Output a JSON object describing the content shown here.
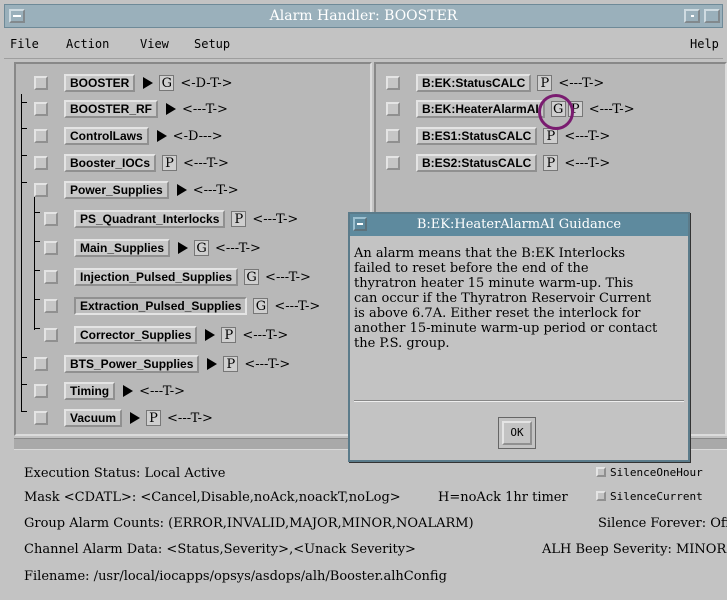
{
  "window": {
    "title": "Alarm Handler: BOOSTER"
  },
  "menu": {
    "file": "File",
    "action": "Action",
    "view": "View",
    "setup": "Setup",
    "help": "Help"
  },
  "tree": [
    {
      "label": "BOOSTER",
      "arrow": true,
      "gp": "G",
      "state": "<-D-T->"
    },
    {
      "label": "BOOSTER_RF",
      "arrow": true,
      "gp": "",
      "state": "<---T->"
    },
    {
      "label": "ControlLaws",
      "arrow": true,
      "gp": "",
      "state": "<-D--->"
    },
    {
      "label": "Booster_IOCs",
      "arrow": false,
      "gp": "P",
      "state": "<---T->"
    },
    {
      "label": "Power_Supplies",
      "arrow": true,
      "gp": "",
      "state": "<---T->"
    },
    {
      "label": "PS_Quadrant_Interlocks",
      "arrow": false,
      "gp": "P",
      "state": "<---T->"
    },
    {
      "label": "Main_Supplies",
      "arrow": true,
      "gp": "G",
      "state": "<---T->"
    },
    {
      "label": "Injection_Pulsed_Supplies",
      "arrow": false,
      "gp": "G",
      "state": "<---T->"
    },
    {
      "label": "Extraction_Pulsed_Supplies",
      "arrow": false,
      "gp": "G",
      "state": "<---T->"
    },
    {
      "label": "Corrector_Supplies",
      "arrow": true,
      "gp": "P",
      "state": "<---T->"
    },
    {
      "label": "BTS_Power_Supplies",
      "arrow": true,
      "gp": "P",
      "state": "<---T->"
    },
    {
      "label": "Timing",
      "arrow": true,
      "gp": "",
      "state": "<---T->"
    },
    {
      "label": "Vacuum",
      "arrow": true,
      "gp": "P",
      "state": "<---T->"
    }
  ],
  "channels": [
    {
      "label": "B:EK:StatusCALC",
      "g": "",
      "p": "P",
      "state": "<---T->"
    },
    {
      "label": "B:EK:HeaterAlarmAI",
      "g": "G",
      "p": "P",
      "state": "<---T->"
    },
    {
      "label": "B:ES1:StatusCALC",
      "g": "",
      "p": "P",
      "state": "<---T->"
    },
    {
      "label": "B:ES2:StatusCALC",
      "g": "",
      "p": "P",
      "state": "<---T->"
    }
  ],
  "status": {
    "execution": "Execution Status:  Local Active",
    "mask": "Mask <CDATL>:  <Cancel,Disable,noAck,noackT,noLog>",
    "timer": "H=noAck 1hr timer",
    "group_counts": "Group Alarm Counts:  (ERROR,INVALID,MAJOR,MINOR,NOALARM)",
    "channel_data": "Channel Alarm Data:  <Status,Severity>,<Unack Severity>",
    "filename": "Filename:   /usr/local/iocapps/opsys/asdops/alh/Booster.alhConfig",
    "silence_one_hour": "SilenceOneHour",
    "silence_current": "SilenceCurrent",
    "silence_forever": "Silence Forever:  Off",
    "beep_severity": "ALH Beep Severity:  MINOR"
  },
  "dialog": {
    "title": "B:EK:HeaterAlarmAI Guidance",
    "lines": [
      "An alarm means that the B:EK Interlocks",
      "failed to reset before the end of the",
      "thyratron heater 15 minute warm-up. This",
      "can occur if the Thyratron Reservoir Current",
      "is above 6.7A. Either reset the interlock for",
      "another 15-minute warm-up period or contact",
      "the P.S. group."
    ],
    "ok": "OK"
  }
}
